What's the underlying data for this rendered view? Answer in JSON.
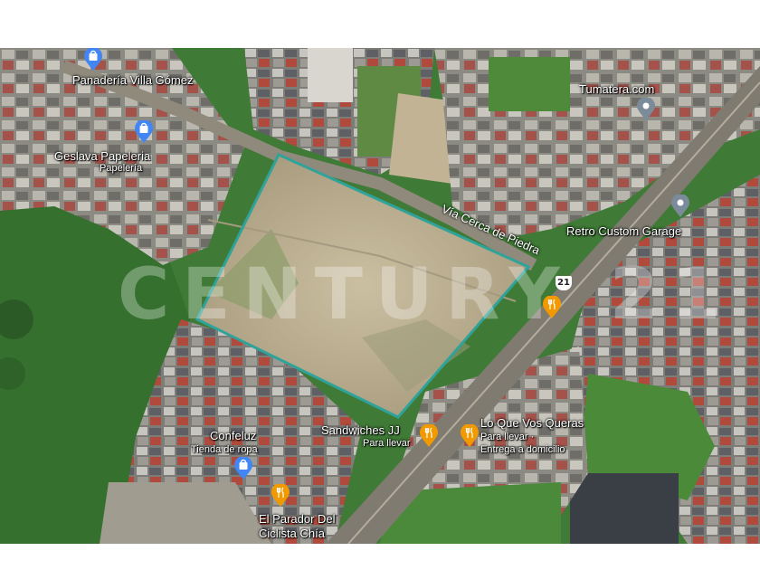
{
  "watermark": "CENTURY 21",
  "road": {
    "name": "Vía Cerca de Piedra",
    "route_number": "21"
  },
  "places": [
    {
      "name": "Panadería Villa Gómez",
      "icon": "shopping-bag-icon",
      "color": "#4285f4"
    },
    {
      "name": "Geslava Papeleria",
      "subtitle": "Papelería",
      "icon": "shopping-bag-icon",
      "color": "#4285f4"
    },
    {
      "name": "Tumatera.com",
      "icon": "place-pin-icon",
      "color": "#7b8b9a"
    },
    {
      "name": "Retro Custom Garage",
      "icon": "place-pin-icon",
      "color": "#7b8b9a"
    },
    {
      "name": "Sandwiches JJ",
      "subtitle": "Para llevar",
      "icon": "restaurant-icon",
      "color": "#f29900"
    },
    {
      "name": "Lo Que Vos Queras",
      "subtitle": "Para llevar ·",
      "subtitle2": "Entrega a domicilio",
      "icon": "restaurant-icon",
      "color": "#f29900"
    },
    {
      "name": "Confeluz",
      "subtitle": "Tienda de ropa",
      "icon": "shopping-bag-icon",
      "color": "#4285f4"
    },
    {
      "name": "El Parador Del",
      "subtitle": "Ciclista Chía",
      "icon": "restaurant-icon",
      "color": "#f29900"
    },
    {
      "name": "",
      "icon": "restaurant-icon",
      "color": "#f29900"
    }
  ],
  "colors": {
    "lot_outline": "#2fa39a",
    "field": "#3d7a35",
    "lot": "#b8ab8e",
    "road": "#8a8576"
  }
}
